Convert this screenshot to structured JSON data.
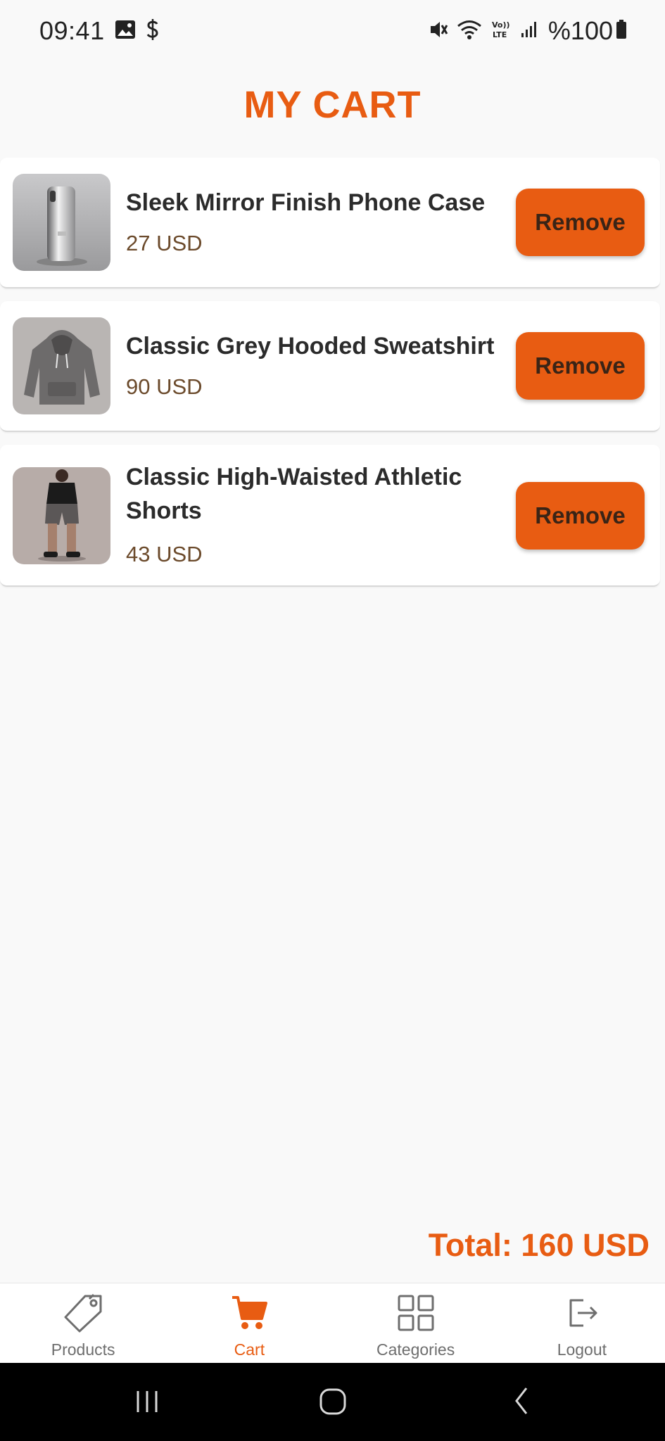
{
  "status_bar": {
    "time": "09:41",
    "battery": "%100",
    "icons": [
      "image-icon",
      "dollar-icon",
      "mute-icon",
      "wifi-icon",
      "volte-icon",
      "signal-icon",
      "battery-icon"
    ]
  },
  "header": {
    "title": "MY CART"
  },
  "cart": {
    "items": [
      {
        "name": "Sleek Mirror Finish Phone Case",
        "price": "27 USD",
        "remove_label": "Remove",
        "image": "phone-case-thumbnail"
      },
      {
        "name": "Classic Grey Hooded Sweatshirt",
        "price": "90 USD",
        "remove_label": "Remove",
        "image": "hoodie-thumbnail"
      },
      {
        "name": "Classic High-Waisted Athletic Shorts",
        "price": "43 USD",
        "remove_label": "Remove",
        "image": "shorts-thumbnail"
      }
    ],
    "total": "Total: 160 USD"
  },
  "bottom_nav": {
    "items": [
      {
        "label": "Products",
        "icon": "tag-icon",
        "active": false
      },
      {
        "label": "Cart",
        "icon": "cart-icon",
        "active": true
      },
      {
        "label": "Categories",
        "icon": "grid-icon",
        "active": false
      },
      {
        "label": "Logout",
        "icon": "logout-icon",
        "active": false
      }
    ]
  },
  "system_nav": {
    "buttons": [
      "recents-icon",
      "home-icon",
      "back-icon"
    ]
  },
  "colors": {
    "accent": "#e85c12",
    "background": "#f9f9f9",
    "card": "#ffffff",
    "price": "#6b4a2b"
  }
}
